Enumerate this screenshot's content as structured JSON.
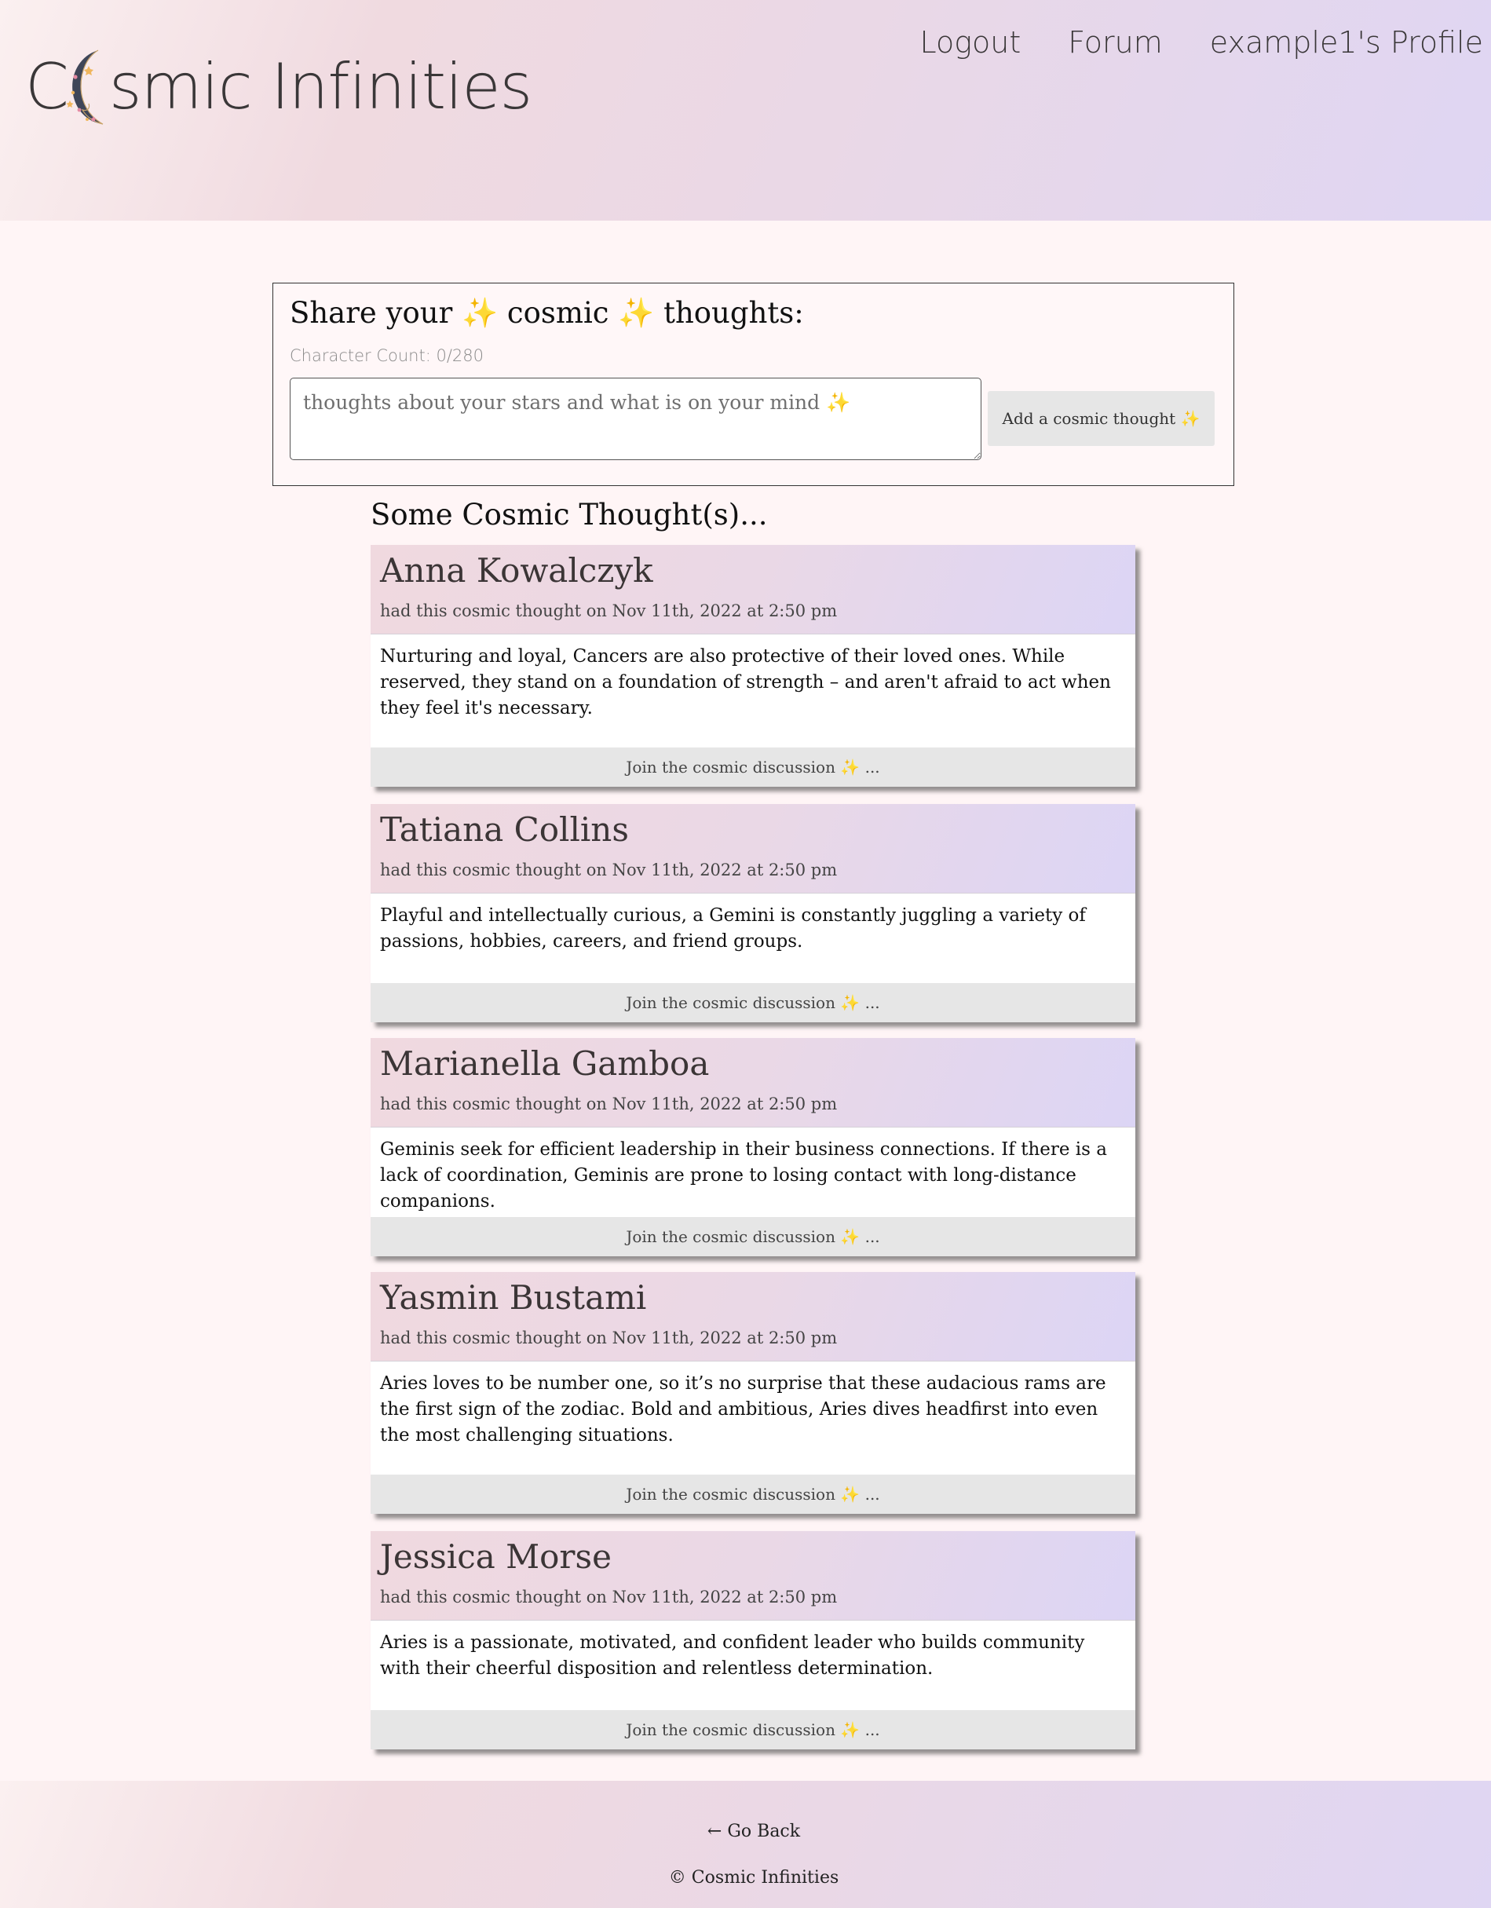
{
  "header": {
    "logo_prefix": "C",
    "logo_suffix": "smic Infinities",
    "nav": {
      "logout": "Logout",
      "forum": "Forum",
      "profile": "example1's Profile"
    }
  },
  "composer": {
    "title": "Share your ✨ cosmic ✨ thoughts:",
    "char_count": "Character Count: 0/280",
    "placeholder": "thoughts about your stars and what is on your mind ✨",
    "value": "",
    "add_button": "Add a cosmic thought ✨"
  },
  "feed": {
    "title": "Some Cosmic Thought(s)...",
    "posts": [
      {
        "author": "Anna Kowalczyk",
        "meta": "had this cosmic thought on Nov 11th, 2022 at 2:50 pm",
        "body": "Nurturing and loyal, Cancers are also protective of their loved ones. While reserved, they stand on a foundation of strength – and aren't afraid to act when they feel it's necessary.",
        "discussion": "Join the cosmic discussion ✨ ..."
      },
      {
        "author": "Tatiana Collins",
        "meta": "had this cosmic thought on Nov 11th, 2022 at 2:50 pm",
        "body": "Playful and intellectually curious, a Gemini is constantly juggling a variety of passions, hobbies, careers, and friend groups.",
        "discussion": "Join the cosmic discussion ✨ ..."
      },
      {
        "author": "Marianella Gamboa",
        "meta": "had this cosmic thought on Nov 11th, 2022 at 2:50 pm",
        "body": "Geminis seek for efficient leadership in their business connections. If there is a lack of coordination, Geminis are prone to losing contact with long-distance companions.",
        "discussion": "Join the cosmic discussion ✨ ..."
      },
      {
        "author": "Yasmin Bustami",
        "meta": "had this cosmic thought on Nov 11th, 2022 at 2:50 pm",
        "body": "Aries loves to be number one, so it’s no surprise that these audacious rams are the first sign of the zodiac. Bold and ambitious, Aries dives headfirst into even the most challenging situations.",
        "discussion": "Join the cosmic discussion ✨ ..."
      },
      {
        "author": "Jessica Morse",
        "meta": "had this cosmic thought on Nov 11th, 2022 at 2:50 pm",
        "body": "Aries is a passionate, motivated, and confident leader who builds community with their cheerful disposition and relentless determination.",
        "discussion": "Join the cosmic discussion ✨ ..."
      }
    ]
  },
  "footer": {
    "go_back": "← Go Back",
    "copyright": "© Cosmic Infinities"
  }
}
